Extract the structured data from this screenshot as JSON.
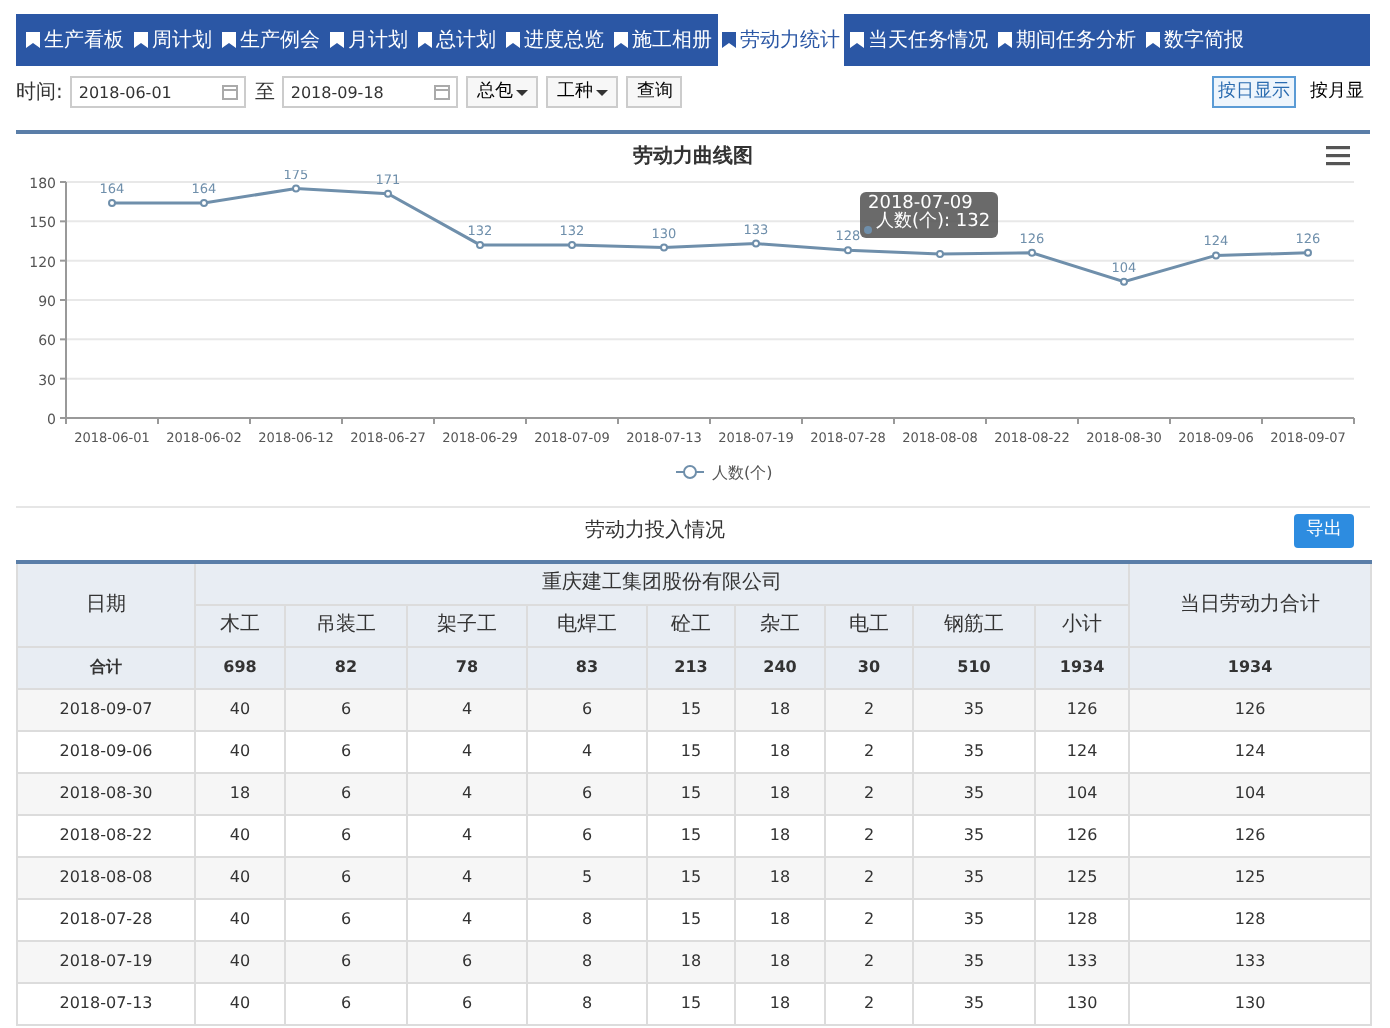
{
  "nav": {
    "tabs": [
      {
        "label": "生产看板",
        "selected": false
      },
      {
        "label": "周计划",
        "selected": false
      },
      {
        "label": "生产例会",
        "selected": false
      },
      {
        "label": "月计划",
        "selected": false
      },
      {
        "label": "总计划",
        "selected": false
      },
      {
        "label": "进度总览",
        "selected": false
      },
      {
        "label": "施工相册",
        "selected": false
      },
      {
        "label": "劳动力统计",
        "selected": true
      },
      {
        "label": "当天任务情况",
        "selected": false
      },
      {
        "label": "期间任务分析",
        "selected": false
      },
      {
        "label": "数字简报",
        "selected": false
      }
    ]
  },
  "filters": {
    "time_label": "时间:",
    "start_date": "2018-06-01",
    "to_label": "至",
    "end_date": "2018-09-18",
    "dropdowns": [
      "总包",
      "工种"
    ],
    "query_button": "查询",
    "view_buttons": [
      {
        "label": "按日显示",
        "selected": true
      },
      {
        "label": "按月显",
        "selected": false
      }
    ]
  },
  "chart_panel": {
    "tooltip": {
      "title": "2018-07-09",
      "text": "人数(个): 132"
    },
    "chart_data": {
      "type": "line",
      "title": "劳动力曲线图",
      "categories": [
        "2018-06-01",
        "2018-06-02",
        "2018-06-12",
        "2018-06-27",
        "2018-06-29",
        "2018-07-09",
        "2018-07-13",
        "2018-07-19",
        "2018-07-28",
        "2018-08-08",
        "2018-08-22",
        "2018-08-30",
        "2018-09-06",
        "2018-09-07"
      ],
      "grid": true,
      "series": [
        {
          "name": "人数(个)",
          "color": "#6f8fab",
          "marker": "circle",
          "values": [
            164,
            164,
            175,
            171,
            132,
            132,
            130,
            133,
            128,
            125,
            126,
            104,
            124,
            126
          ]
        }
      ],
      "value_labels": [
        "164",
        "164",
        "175",
        "171",
        "132",
        "132",
        "130",
        "133",
        "128",
        null,
        "126",
        "104",
        "124",
        "126"
      ],
      "ylim": [
        0,
        180
      ],
      "yticks": [
        0,
        30,
        60,
        90,
        120,
        150,
        180
      ]
    }
  },
  "table_panel": {
    "title": "劳动力投入情况",
    "export_button": "导出",
    "table": {
      "group_header": "重庆建工集团股份有限公司",
      "columns": [
        "日期",
        "木工",
        "吊装工",
        "架子工",
        "电焊工",
        "砼工",
        "杂工",
        "电工",
        "钢筋工",
        "小计",
        "当日劳动力合计"
      ],
      "rows": [
        {
          "kind": "total",
          "cells": [
            "合计",
            "698",
            "82",
            "78",
            "83",
            "213",
            "240",
            "30",
            "510",
            "1934",
            "1934"
          ]
        },
        {
          "kind": "data",
          "cells": [
            "2018-09-07",
            "40",
            "6",
            "4",
            "6",
            "15",
            "18",
            "2",
            "35",
            "126",
            "126"
          ]
        },
        {
          "kind": "data",
          "cells": [
            "2018-09-06",
            "40",
            "6",
            "4",
            "4",
            "15",
            "18",
            "2",
            "35",
            "124",
            "124"
          ]
        },
        {
          "kind": "data",
          "cells": [
            "2018-08-30",
            "18",
            "6",
            "4",
            "6",
            "15",
            "18",
            "2",
            "35",
            "104",
            "104"
          ]
        },
        {
          "kind": "data",
          "cells": [
            "2018-08-22",
            "40",
            "6",
            "4",
            "6",
            "15",
            "18",
            "2",
            "35",
            "126",
            "126"
          ]
        },
        {
          "kind": "data",
          "cells": [
            "2018-08-08",
            "40",
            "6",
            "4",
            "5",
            "15",
            "18",
            "2",
            "35",
            "125",
            "125"
          ]
        },
        {
          "kind": "data",
          "cells": [
            "2018-07-28",
            "40",
            "6",
            "4",
            "8",
            "15",
            "18",
            "2",
            "35",
            "128",
            "128"
          ]
        },
        {
          "kind": "data",
          "cells": [
            "2018-07-19",
            "40",
            "6",
            "6",
            "8",
            "18",
            "18",
            "2",
            "35",
            "133",
            "133"
          ]
        },
        {
          "kind": "data",
          "cells": [
            "2018-07-13",
            "40",
            "6",
            "6",
            "8",
            "15",
            "18",
            "2",
            "35",
            "130",
            "130"
          ]
        }
      ]
    }
  }
}
